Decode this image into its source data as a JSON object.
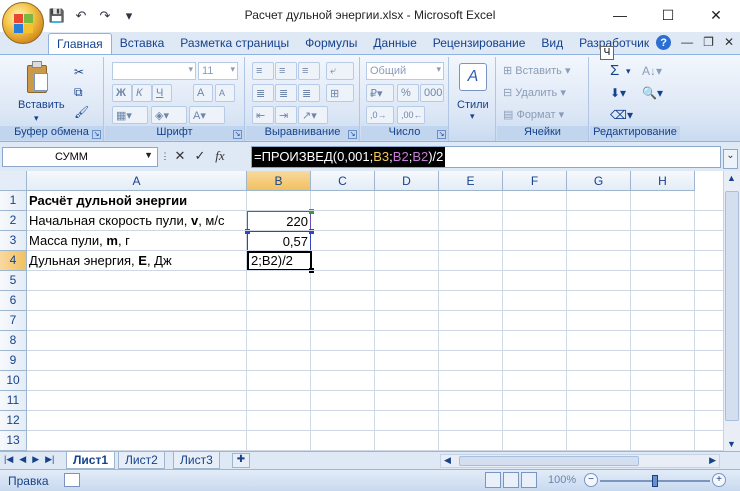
{
  "window": {
    "title": "Расчет дульной энергии.xlsx - Microsoft Excel",
    "minimize": "—",
    "maximize": "☐",
    "close": "✕"
  },
  "qat": {
    "save": "💾",
    "undo": "↶",
    "redo": "↷",
    "customize": "▾"
  },
  "ribbon_tabs": [
    "Главная",
    "Вставка",
    "Разметка страницы",
    "Формулы",
    "Данные",
    "Рецензирование",
    "Вид",
    "Разработчик"
  ],
  "active_tab": "Главная",
  "tab_right": {
    "help": "?",
    "minimize": "—",
    "restore": "❐",
    "close": "✕",
    "keytip": "Ч"
  },
  "ribbon": {
    "clipboard": {
      "label": "Буфер обмена",
      "paste": "Вставить"
    },
    "font": {
      "label": "Шрифт",
      "size": "11",
      "bold": "Ж",
      "italic": "К",
      "underline": "Ч",
      "grow": "A",
      "shrink": "A"
    },
    "alignment": {
      "label": "Выравнивание"
    },
    "number": {
      "label": "Число",
      "format": "Общий",
      "percent": "%",
      "thousands": "000"
    },
    "styles": {
      "label": "Стили"
    },
    "cells": {
      "label": "Ячейки",
      "insert": "Вставить",
      "delete": "Удалить",
      "format": "Формат"
    },
    "editing": {
      "label": "Редактирование",
      "sum": "Σ"
    }
  },
  "formula_bar": {
    "name_box": "СУММ",
    "cancel": "✕",
    "enter": "✓",
    "fx": "fx",
    "formula_parts": [
      {
        "text": "=ПРОИЗВЕД(0,001;",
        "color": "#ffffff"
      },
      {
        "text": "B3",
        "color": "#f0c95a"
      },
      {
        "text": ";",
        "color": "#ffffff"
      },
      {
        "text": "B2",
        "color": "#c87bd8"
      },
      {
        "text": ";",
        "color": "#ffffff"
      },
      {
        "text": "B2",
        "color": "#c87bd8"
      },
      {
        "text": ")/2",
        "color": "#ffffff"
      }
    ]
  },
  "columns": [
    "A",
    "B",
    "C",
    "D",
    "E",
    "F",
    "G",
    "H"
  ],
  "rows": [
    "1",
    "2",
    "3",
    "4",
    "5",
    "6",
    "7",
    "8",
    "9",
    "10",
    "11",
    "12",
    "13"
  ],
  "cells": {
    "A1": "Расчёт дульной энергии",
    "A2_pre": "Начальная скорость пули, ",
    "A2_bold": "v",
    "A2_post": ", м/с",
    "A3_pre": "Масса пули, ",
    "A3_bold": "m",
    "A3_post": ", г",
    "A4_pre": "Дульная энергия, ",
    "A4_bold": "E",
    "A4_post": ", Дж",
    "B2": "220",
    "B3": "0,57",
    "B4": "2;B2)/2"
  },
  "sheets": [
    "Лист1",
    "Лист2",
    "Лист3"
  ],
  "active_sheet": "Лист1",
  "status": {
    "mode": "Правка",
    "zoom": "100%"
  }
}
